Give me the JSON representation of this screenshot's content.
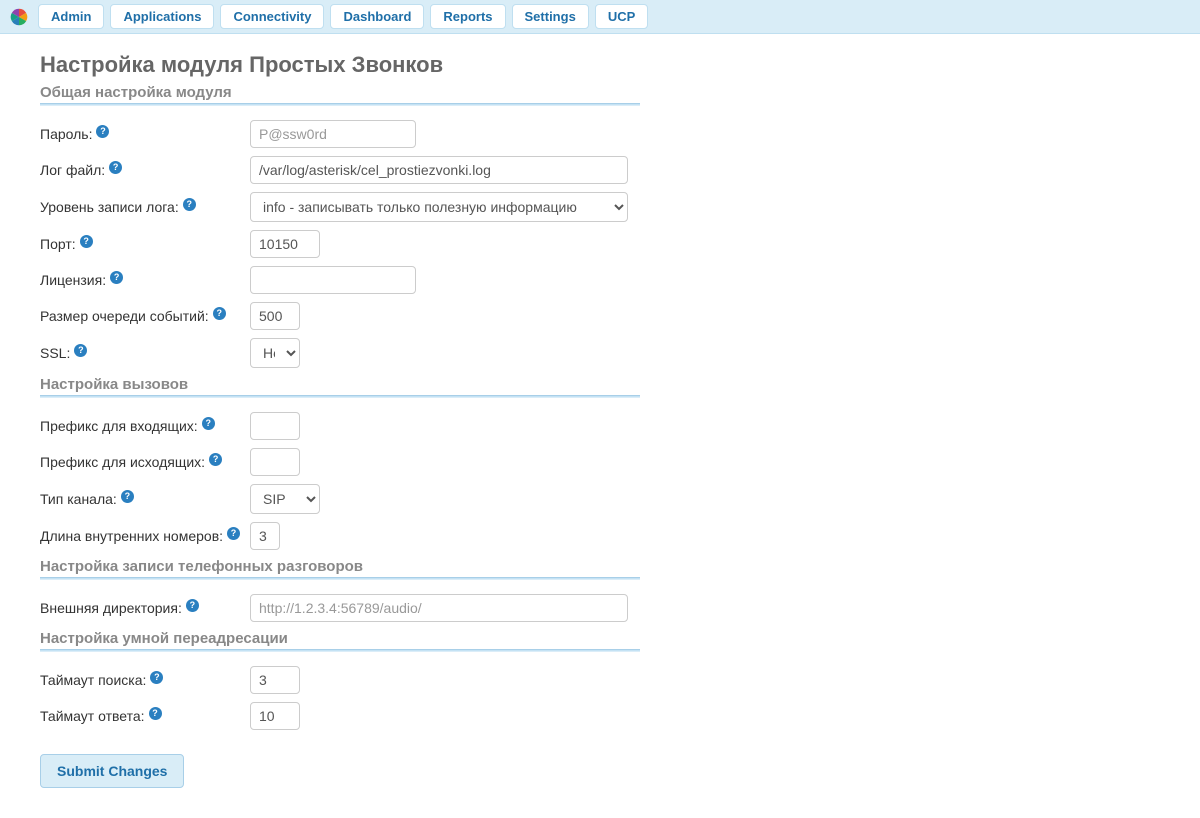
{
  "nav": {
    "items": [
      "Admin",
      "Applications",
      "Connectivity",
      "Dashboard",
      "Reports",
      "Settings",
      "UCP"
    ]
  },
  "page": {
    "title": "Настройка модуля Простых Звонков"
  },
  "sections": {
    "general": {
      "heading": "Общая настройка модуля",
      "password_label": "Пароль:",
      "password_placeholder": "P@ssw0rd",
      "password_value": "",
      "log_label": "Лог файл:",
      "log_value": "/var/log/asterisk/cel_prostiezvonki.log",
      "loglevel_label": "Уровень записи лога:",
      "loglevel_selected": "info - записывать только полезную информацию",
      "port_label": "Порт:",
      "port_value": "10150",
      "license_label": "Лицензия:",
      "license_value": "",
      "queue_label": "Размер очереди событий:",
      "queue_value": "500",
      "ssl_label": "SSL:",
      "ssl_selected": "Нет"
    },
    "calls": {
      "heading": "Настройка вызовов",
      "incoming_prefix_label": "Префикс для входящих:",
      "incoming_prefix_value": "",
      "outgoing_prefix_label": "Префикс для исходящих:",
      "outgoing_prefix_value": "",
      "channel_label": "Тип канала:",
      "channel_selected": "SIP",
      "ext_len_label": "Длина внутренних номеров:",
      "ext_len_value": "3"
    },
    "recording": {
      "heading": "Настройка записи телефонных разговоров",
      "ext_dir_label": "Внешняя директория:",
      "ext_dir_placeholder": "http://1.2.3.4:56789/audio/",
      "ext_dir_value": ""
    },
    "smart": {
      "heading": "Настройка умной переадресации",
      "search_timeout_label": "Таймаут поиска:",
      "search_timeout_value": "3",
      "answer_timeout_label": "Таймаут ответа:",
      "answer_timeout_value": "10"
    }
  },
  "actions": {
    "submit": "Submit Changes"
  }
}
